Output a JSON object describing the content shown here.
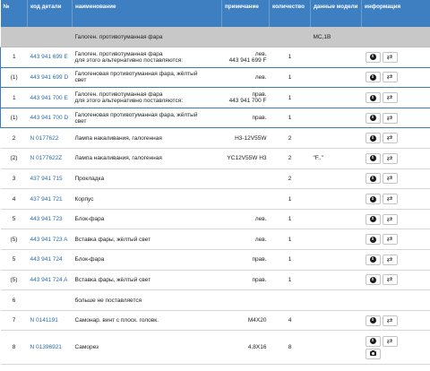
{
  "headers": [
    "№",
    "код детали",
    "наименование",
    "примечание",
    "количество",
    "данные модели",
    "информация"
  ],
  "group": {
    "label": "Галоген. противотуманная фара",
    "model": "MC,1B"
  },
  "rows": [
    {
      "pos": "1",
      "part": "443 941 699 E",
      "name1": "Галоген. противотуманная фара",
      "name2": "для этого альтернативно поставляются:",
      "note1": "лев.",
      "note2": "443 941 699 F",
      "qty": "1",
      "model": ""
    },
    {
      "pos": "(1)",
      "part": "443 941 699 D",
      "name1": "Галогеновая противотуманная фара, жёлтый",
      "name2": "свет",
      "note1": "лев.",
      "note2": "",
      "qty": "1",
      "model": ""
    },
    {
      "pos": "1",
      "part": "443 941 700 E",
      "name1": "Галоген. противотуманная фара",
      "name2": "для этого альтернативно поставляются:",
      "note1": "прав.",
      "note2": "443 941 700 F",
      "qty": "1",
      "model": ""
    },
    {
      "pos": "(1)",
      "part": "443 941 700 D",
      "name1": "Галогеновая противотуманная фара, жёлтый",
      "name2": "свет",
      "note1": "прав.",
      "note2": "",
      "qty": "1",
      "model": ""
    },
    {
      "pos": "2",
      "part": "N  0177622",
      "name1": "Лампа накаливания, галогенная",
      "name2": "",
      "note1": "H3-12V55W",
      "note2": "",
      "qty": "2",
      "model": ""
    },
    {
      "pos": "(2)",
      "part": "N  0177622Z",
      "name1": "Лампа накаливания, галогенная",
      "name2": "",
      "note1": "YC12V55W H3",
      "note2": "",
      "qty": "2",
      "model": "\"F..\""
    },
    {
      "pos": "3",
      "part": "437 941 715",
      "name1": "Прокладка",
      "name2": "",
      "note1": "",
      "note2": "",
      "qty": "2",
      "model": ""
    },
    {
      "pos": "4",
      "part": "437 941 721",
      "name1": "Корпус",
      "name2": "",
      "note1": "",
      "note2": "",
      "qty": "1",
      "model": ""
    },
    {
      "pos": "5",
      "part": "443 941 723",
      "name1": "Блок-фара",
      "name2": "",
      "note1": "лев.",
      "note2": "",
      "qty": "1",
      "model": ""
    },
    {
      "pos": "(5)",
      "part": "443 941 723 A",
      "name1": "Вставка фары, жёлтый свет",
      "name2": "",
      "note1": "лев.",
      "note2": "",
      "qty": "1",
      "model": ""
    },
    {
      "pos": "5",
      "part": "443 941 724",
      "name1": "Блок-фара",
      "name2": "",
      "note1": "прав.",
      "note2": "",
      "qty": "1",
      "model": ""
    },
    {
      "pos": "(5)",
      "part": "443 941 724 A",
      "name1": "Вставка фары, жёлтый свет",
      "name2": "",
      "note1": "прав.",
      "note2": "",
      "qty": "1",
      "model": ""
    },
    {
      "pos": "6",
      "part": "",
      "name1": "больше не поставляется",
      "name2": "",
      "note1": "",
      "note2": "",
      "qty": "",
      "model": ""
    },
    {
      "pos": "7",
      "part": "N  0141191",
      "name1": "Самонар. винт с плоск. головк.",
      "name2": "",
      "note1": "M4X20",
      "note2": "",
      "qty": "4",
      "model": ""
    },
    {
      "pos": "8",
      "part": "N  01396921",
      "name1": "Саморез",
      "name2": "",
      "note1": "4,8X16",
      "note2": "",
      "qty": "8",
      "model": ""
    }
  ],
  "icons": {
    "info": "info-circle-icon",
    "swap": "exchange-arrows-icon",
    "camera": "camera-icon"
  },
  "colors": {
    "header_bg": "#3e7fc1",
    "link": "#2a6db0",
    "frame": "#3c7bbd",
    "group_bg": "#c8c8c8"
  }
}
